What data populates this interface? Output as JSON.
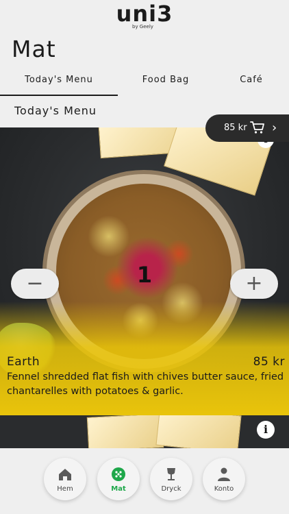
{
  "header": {
    "logo_text": "uni3",
    "logo_sub": "by Geely",
    "page_title": "Mat"
  },
  "tabs": [
    {
      "label": "Today's Menu",
      "active": true
    },
    {
      "label": "Food Bag",
      "active": false
    },
    {
      "label": "Café",
      "active": false
    }
  ],
  "section_title": "Today's Menu",
  "cart": {
    "price": "85 kr",
    "icon": "cart-icon",
    "chevron": "›"
  },
  "dish": {
    "quantity": "1",
    "name": "Earth",
    "price": "85 kr",
    "description": "Fennel shredded flat fish with chives butter sauce, fried chantarelles with potatoes & garlic.",
    "minus_label": "−",
    "plus_label": "+",
    "info_label": "i"
  },
  "next_dish": {
    "info_label": "i"
  },
  "bottom_nav": [
    {
      "label": "Hem",
      "icon": "home-icon",
      "active": false
    },
    {
      "label": "Mat",
      "icon": "food-icon",
      "active": true
    },
    {
      "label": "Dryck",
      "icon": "glass-icon",
      "active": false
    },
    {
      "label": "Konto",
      "icon": "person-icon",
      "active": false
    }
  ],
  "colors": {
    "accent": "#1ea74a",
    "highlight": "#e9c40b",
    "dark": "#2b2b2b"
  }
}
